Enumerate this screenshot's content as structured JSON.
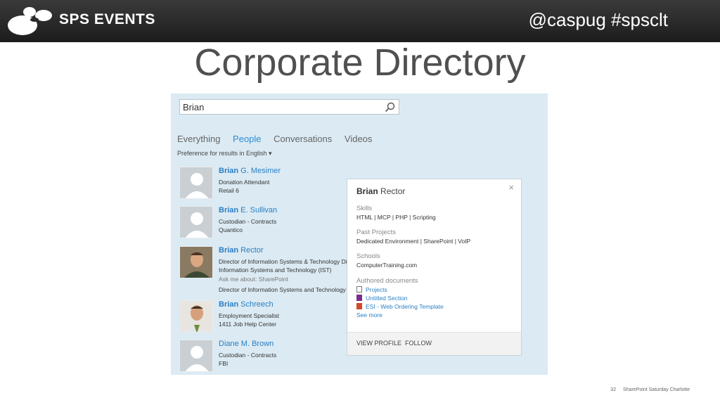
{
  "header": {
    "brand": "SPS EVENTS",
    "handle": "@caspug #spsclt"
  },
  "slide": {
    "title": "Corporate Directory"
  },
  "search": {
    "value": "Brian"
  },
  "tabs": [
    "Everything",
    "People",
    "Conversations",
    "Videos"
  ],
  "active_tab": "People",
  "preference": "Preference for results in English ▾",
  "results": [
    {
      "first": "Brian",
      "rest": " G. Mesimer",
      "line1": "Donation Attendant",
      "line2": "Retail 6"
    },
    {
      "first": "Brian",
      "rest": " E. Sullivan",
      "line1": "Custodian - Contracts",
      "line2": "Quantico"
    },
    {
      "first": "Brian",
      "rest": " Rector",
      "line1": "Director of Information Systems & Technology Dir",
      "line2": "Information Systems and Technology (IST)",
      "ask": "Ask me about: SharePoint",
      "line3": "Director of Information Systems and Technology"
    },
    {
      "first": "Brian",
      "rest": " Schreech",
      "line1": "Employment Specialist",
      "line2": "1411 Job Help Center"
    },
    {
      "first": "",
      "rest": "Diane M. Brown",
      "line1": "Custodian - Contracts",
      "line2": "FBI"
    }
  ],
  "card": {
    "first": "Brian",
    "rest": " Rector",
    "skills_h": "Skills",
    "skills": "HTML | MCP | PHP | Scripting",
    "projects_h": "Past Projects",
    "projects": "Dedicated Environment | SharePoint | VoIP",
    "schools_h": "Schools",
    "schools": "ComputerTraining.com",
    "docs_h": "Authored documents",
    "docs": [
      "Projects",
      "Untitled Section",
      "ESI - Web Ordering Template"
    ],
    "see_more": "See more",
    "view_profile": "VIEW PROFILE",
    "follow": "FOLLOW"
  },
  "footer": {
    "page": "32",
    "event": "SharePoint Saturday Charlotte"
  }
}
